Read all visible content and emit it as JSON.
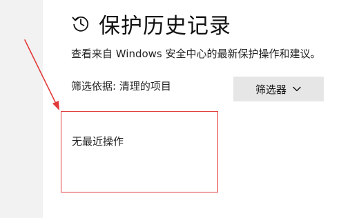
{
  "header": {
    "title": "保护历史记录",
    "icon": "history-icon"
  },
  "description": "查看来自 Windows 安全中心的最新保护操作和建议。",
  "filter": {
    "label": "筛选依据: 清理的项目",
    "button_label": "筛选器",
    "button_icon": "chevron-down-icon"
  },
  "results": {
    "empty_message": "无最近操作"
  },
  "annotation": {
    "arrow_color": "#e23a3a",
    "box_color": "#e23a3a"
  }
}
